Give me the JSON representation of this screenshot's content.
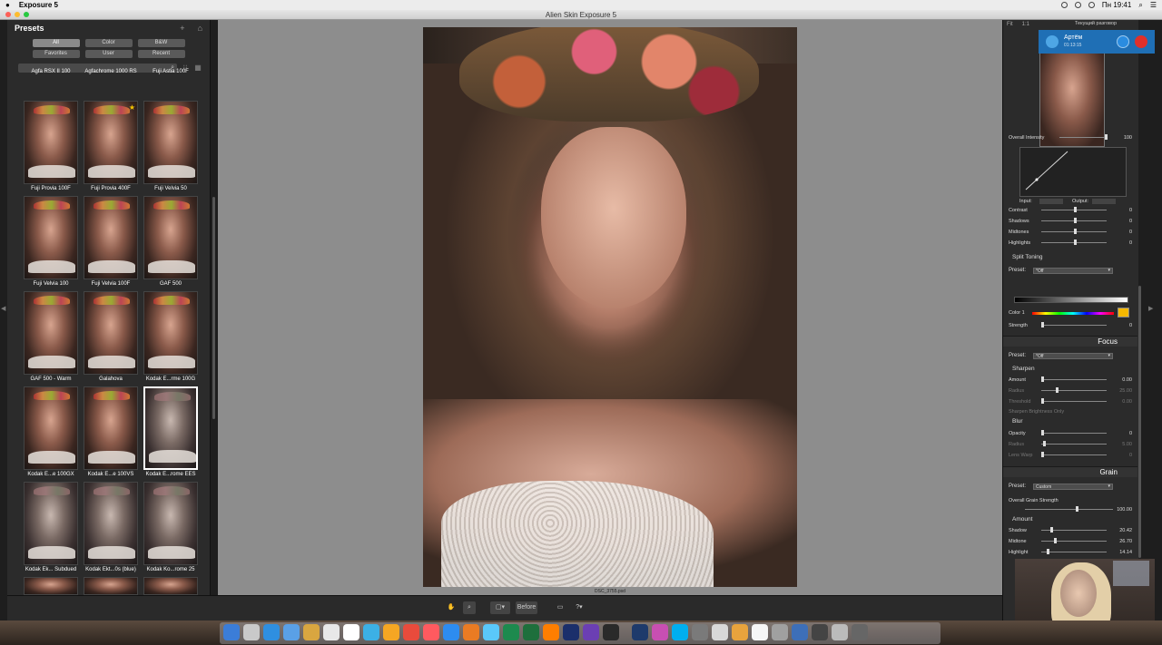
{
  "menubar": {
    "app": "Exposure 5",
    "clock": "Пн 19:41"
  },
  "window": {
    "title": "Alien Skin Exposure 5"
  },
  "presets": {
    "title": "Presets",
    "add": "+",
    "filters": [
      "All",
      "Color",
      "B&W",
      "Favorites",
      "User",
      "Recent"
    ],
    "active_filter": "All",
    "top_row_labels": [
      "Agfa RSX II 100",
      "Agfachrome 1000 RS",
      "Fuji Astia 100F"
    ],
    "items": [
      "Fuji Provia 100F",
      "Fuji Provia 400F",
      "Fuji Velvia 50",
      "Fuji Velvia 100",
      "Fuji Velvia 100F",
      "GAF 500",
      "GAF 500 - Warm",
      "Galahova",
      "Kodak E...rme 100G",
      "Kodak E...e 100GX",
      "Kodak E...e 100VS",
      "Kodak E...rome EES",
      "Kodak Ek... Subdued",
      "Kodak Ekt...0s (blue)",
      "Kodak Ko...rome 25"
    ],
    "selected_index": 11,
    "favorite_index": 1
  },
  "canvas": {
    "filename": "DSC_3755.psd"
  },
  "toolbar": {
    "before_label": "Before"
  },
  "right": {
    "fit": "Fit",
    "ratio": "1:1",
    "call_label": "Текущий разговор",
    "overall": {
      "label": "Overall Intensity",
      "value": "100"
    },
    "curve": {
      "input": "Input:",
      "output": "Output:"
    },
    "tone_rows": [
      {
        "label": "Contrast",
        "value": "0"
      },
      {
        "label": "Shadows",
        "value": "0"
      },
      {
        "label": "Midtones",
        "value": "0"
      },
      {
        "label": "Highlights",
        "value": "0"
      }
    ],
    "split_toning": {
      "title": "Split Toning",
      "preset_label": "Preset:",
      "preset_value": "*Off",
      "color_label": "Color 1",
      "strength_label": "Strength",
      "strength_value": "0",
      "swatch": "#f5b800"
    },
    "focus": {
      "title": "Focus",
      "preset_label": "Preset:",
      "preset_value": "*Off",
      "sharpen": "Sharpen",
      "sharpen_rows": [
        {
          "label": "Amount",
          "value": "0.00",
          "dim": false
        },
        {
          "label": "Radius",
          "value": "25.00",
          "dim": true
        },
        {
          "label": "Threshold",
          "value": "0.00",
          "dim": true
        }
      ],
      "sharpen_brightness": "Sharpen Brightness Only",
      "blur": "Blur",
      "blur_rows": [
        {
          "label": "Opacity",
          "value": "0",
          "dim": false
        },
        {
          "label": "Radius",
          "value": "5.00",
          "dim": true
        },
        {
          "label": "Lens Warp",
          "value": "0",
          "dim": true
        }
      ]
    },
    "grain": {
      "title": "Grain",
      "preset_label": "Preset:",
      "preset_value": "Custom",
      "overall_label": "Overall Grain Strength",
      "overall_value": "100.00",
      "amount": "Amount",
      "rows": [
        {
          "label": "Shadow",
          "value": "20.42"
        },
        {
          "label": "Midtone",
          "value": "26.70"
        },
        {
          "label": "Highlight",
          "value": "14.14"
        }
      ]
    }
  },
  "call": {
    "name": "Артём",
    "sub": "01:13:15"
  }
}
